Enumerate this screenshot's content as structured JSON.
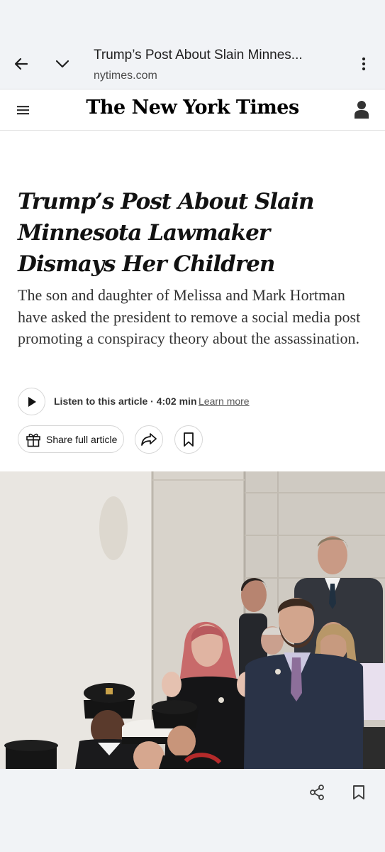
{
  "browser": {
    "tab_title": "Trump’s Post About Slain Minnes...",
    "url": "nytimes.com"
  },
  "header": {
    "logo": "The New York Times"
  },
  "article": {
    "headline": "Trump’s Post About Slain Minnesota Lawmaker Dismays Her Children",
    "summary": "The son and daughter of Melissa and Mark Hortman have asked the president to remove a social media post promoting a conspiracy theory about the assassination.",
    "listen_label": "Listen to this article · 4:02 min",
    "learn_more": "Learn more",
    "share_full": "Share full article"
  },
  "icons": {
    "back": "back-arrow-icon",
    "expand": "chevron-down-icon",
    "more": "more-vertical-icon",
    "menu": "hamburger-menu-icon",
    "account": "account-icon",
    "play": "play-icon",
    "gift": "gift-icon",
    "share": "share-arrow-icon",
    "bookmark": "bookmark-icon",
    "share_nodes": "share-nodes-icon"
  },
  "colors": {
    "chrome_bg": "#f1f3f6",
    "text": "#121212",
    "border": "#d6d6d6"
  }
}
